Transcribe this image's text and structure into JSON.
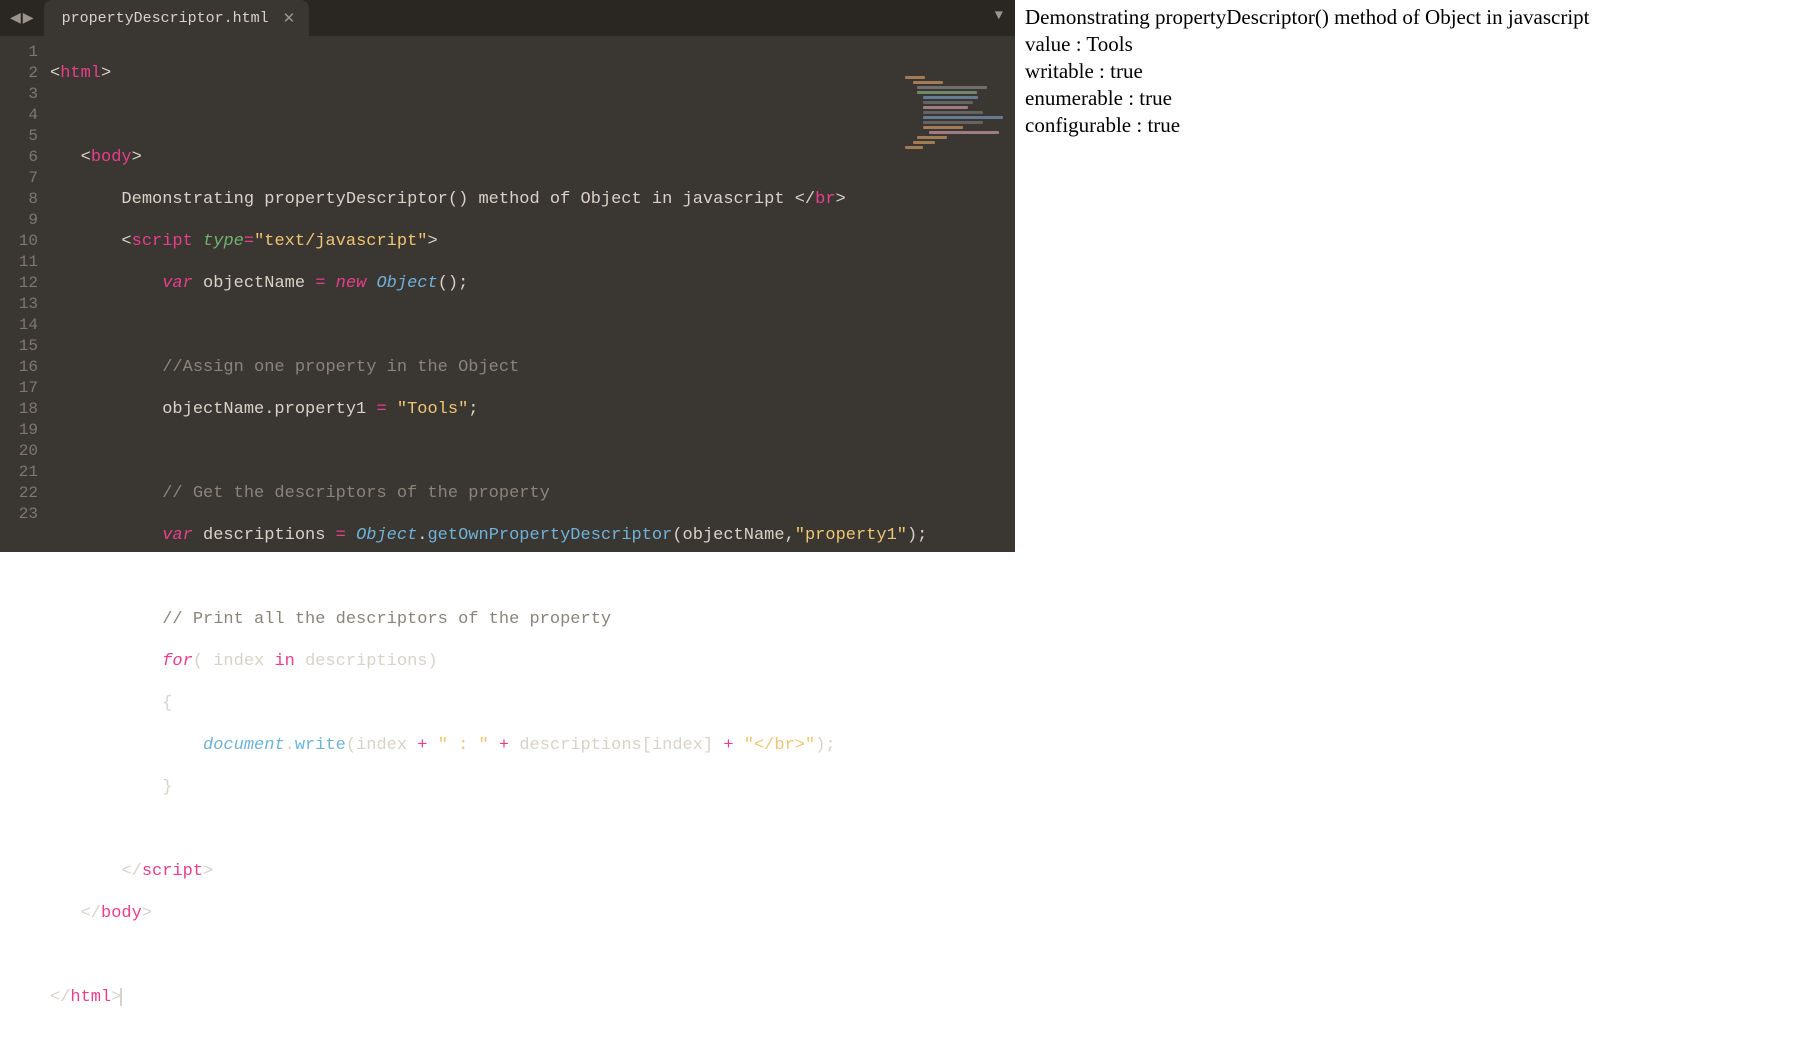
{
  "tab": {
    "title": "propertyDescriptor.html"
  },
  "gutter": [
    "1",
    "2",
    "3",
    "4",
    "5",
    "6",
    "7",
    "8",
    "9",
    "10",
    "11",
    "12",
    "13",
    "14",
    "15",
    "16",
    "17",
    "18",
    "19",
    "20",
    "21",
    "22",
    "23"
  ],
  "code": {
    "l1_tag": "html",
    "l3_tag": "body",
    "l4_text": "Demonstrating propertyDescriptor() method of Object in javascript ",
    "l4_br": "br",
    "l5_tag": "script",
    "l5_attr": "type",
    "l5_val": "\"text/javascript\"",
    "l6_var": "var",
    "l6_name": "objectName",
    "l6_new": "new",
    "l6_obj": "Object",
    "l8_cmt": "//Assign one property in the Object",
    "l9_lhs": "objectName.property1",
    "l9_val": "\"Tools\"",
    "l11_cmt": "// Get the descriptors of the property",
    "l12_var": "var",
    "l12_name": "descriptions",
    "l12_obj": "Object",
    "l12_fn": "getOwnPropertyDescriptor",
    "l12_arg1": "objectName",
    "l12_arg2": "\"property1\"",
    "l14_cmt": "// Print all the descriptors of the property",
    "l15_for": "for",
    "l15_idx": "index",
    "l15_in": "in",
    "l15_coll": "descriptions",
    "l17_doc": "document",
    "l17_fn": "write",
    "l17_idx": "index",
    "l17_s1": "\" : \"",
    "l17_coll": "descriptions",
    "l17_idx2": "index",
    "l17_s2": "\"</br>\"",
    "l20_tag": "script",
    "l21_tag": "body",
    "l23_tag": "html"
  },
  "output": {
    "line1": "Demonstrating propertyDescriptor() method of Object in javascript",
    "line2": "value : Tools",
    "line3": "writable : true",
    "line4": "enumerable : true",
    "line5": "configurable : true"
  }
}
